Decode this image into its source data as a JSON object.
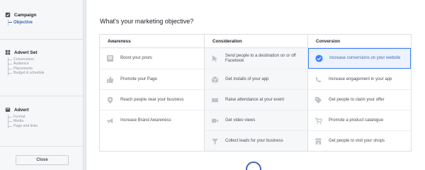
{
  "sidebar": {
    "campaign": {
      "title": "Campaign",
      "items": [
        {
          "label": "Objective",
          "active": true
        }
      ]
    },
    "advert_set": {
      "title": "Advert Set",
      "items": [
        {
          "label": "Conversions"
        },
        {
          "label": "Audience"
        },
        {
          "label": "Placements"
        },
        {
          "label": "Budget & schedule"
        }
      ]
    },
    "advert": {
      "title": "Advert",
      "items": [
        {
          "label": "Format"
        },
        {
          "label": "Media"
        },
        {
          "label": "Page and links"
        }
      ]
    },
    "close_label": "Close"
  },
  "main": {
    "question": "What's your marketing objective?",
    "columns": [
      {
        "title": "Awareness",
        "options": [
          {
            "label": "Boost your posts",
            "icon": "boost-post-icon"
          },
          {
            "label": "Promote your Page",
            "icon": "thumbs-up-icon"
          },
          {
            "label": "Reach people near your business",
            "icon": "location-pin-icon"
          },
          {
            "label": "Increase Brand Awareness",
            "icon": "megaphone-icon"
          }
        ]
      },
      {
        "title": "Consideration",
        "options": [
          {
            "label": "Send people to a destination on or off Facebook",
            "icon": "cursor-icon"
          },
          {
            "label": "Get installs of your app",
            "icon": "app-box-icon"
          },
          {
            "label": "Raise attendance at your event",
            "icon": "event-ticket-icon"
          },
          {
            "label": "Get video views",
            "icon": "video-camera-icon"
          },
          {
            "label": "Collect leads for your business",
            "icon": "funnel-icon"
          }
        ]
      },
      {
        "title": "Conversion",
        "options": [
          {
            "label": "Increase conversions on your website",
            "icon": "check-circle-icon",
            "selected": true
          },
          {
            "label": "Increase engagement in your app",
            "icon": "phone-icon"
          },
          {
            "label": "Get people to claim your offer",
            "icon": "offer-tag-icon"
          },
          {
            "label": "Promote a product catalogue",
            "icon": "shopping-cart-icon"
          },
          {
            "label": "Get people to visit your shops",
            "icon": "store-icon"
          }
        ]
      }
    ]
  },
  "colors": {
    "accent": "#4267b2",
    "selected_bg": "#ecf3ff",
    "selected_border": "#4080ff",
    "icon_gray": "#90949c"
  }
}
